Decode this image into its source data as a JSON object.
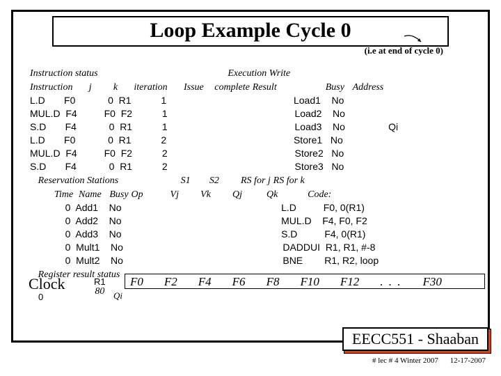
{
  "title": "Loop Example Cycle 0",
  "subtitle": "(i.e at end of cycle 0)",
  "headers": {
    "instr_status": "Instruction status",
    "instruction": "Instruction",
    "j": "j",
    "k": "k",
    "iteration": "iteration",
    "issue": "Issue",
    "exec_complete": "Execution\ncomplete",
    "write_result": "Write\nResult",
    "busy": "Busy",
    "address": "Address",
    "reservation": "Reservation Stations",
    "time": "Time",
    "name": "Name",
    "busy2": "Busy",
    "op": "Op",
    "s1": "S1",
    "vj": "Vj",
    "s2": "S2",
    "vk": "Vk",
    "rsj": "RS for j",
    "qj": "Qj",
    "rsk": "RS for k",
    "qk": "Qk",
    "code": "Code:",
    "register_status": "Register result status"
  },
  "instructions": [
    {
      "op": "L.D",
      "dst": "F0",
      "j": "0",
      "k": "R1",
      "iter": "1"
    },
    {
      "op": "MUL.D",
      "dst": "F4",
      "j": "F0",
      "k": "F2",
      "iter": "1"
    },
    {
      "op": "S.D",
      "dst": "F4",
      "j": "0",
      "k": "R1",
      "iter": "1"
    },
    {
      "op": "L.D",
      "dst": "F0",
      "j": "0",
      "k": "R1",
      "iter": "2"
    },
    {
      "op": "MUL.D",
      "dst": "F4",
      "j": "F0",
      "k": "F2",
      "iter": "2"
    },
    {
      "op": "S.D",
      "dst": "F4",
      "j": "0",
      "k": "R1",
      "iter": "2"
    }
  ],
  "fu": [
    {
      "name": "Load1",
      "busy": "No",
      "addr": ""
    },
    {
      "name": "Load2",
      "busy": "No",
      "addr": ""
    },
    {
      "name": "Load3",
      "busy": "No",
      "addr": "Qi"
    },
    {
      "name": "Store1",
      "busy": "No",
      "addr": ""
    },
    {
      "name": "Store2",
      "busy": "No",
      "addr": ""
    },
    {
      "name": "Store3",
      "busy": "No",
      "addr": ""
    }
  ],
  "rs": [
    {
      "time": "0",
      "name": "Add1",
      "busy": "No"
    },
    {
      "time": "0",
      "name": "Add2",
      "busy": "No"
    },
    {
      "time": "0",
      "name": "Add3",
      "busy": "No"
    },
    {
      "time": "0",
      "name": "Mult1",
      "busy": "No"
    },
    {
      "time": "0",
      "name": "Mult2",
      "busy": "No"
    }
  ],
  "code": [
    {
      "op": "L.D",
      "args": "F0, 0(R1)"
    },
    {
      "op": "MUL.D",
      "args": "F4, F0, F2"
    },
    {
      "op": "S.D",
      "args": "F4, 0(R1)"
    },
    {
      "op": "DADDUI",
      "args": "R1, R1, #-8"
    },
    {
      "op": "BNE",
      "args": "R1, R2, loop"
    }
  ],
  "clock": {
    "label": "Clock",
    "value": "0",
    "r1_label": "R1",
    "r1_value": "80",
    "qi_label": "Qi"
  },
  "regs": [
    "F0",
    "F2",
    "F4",
    "F6",
    "F8",
    "F10",
    "F12",
    ".  .  .",
    "F30"
  ],
  "eecc": "EECC551 - Shaaban",
  "footer": {
    "lec": "#  lec # 4  Winter 2007",
    "date": "12-17-2007"
  }
}
